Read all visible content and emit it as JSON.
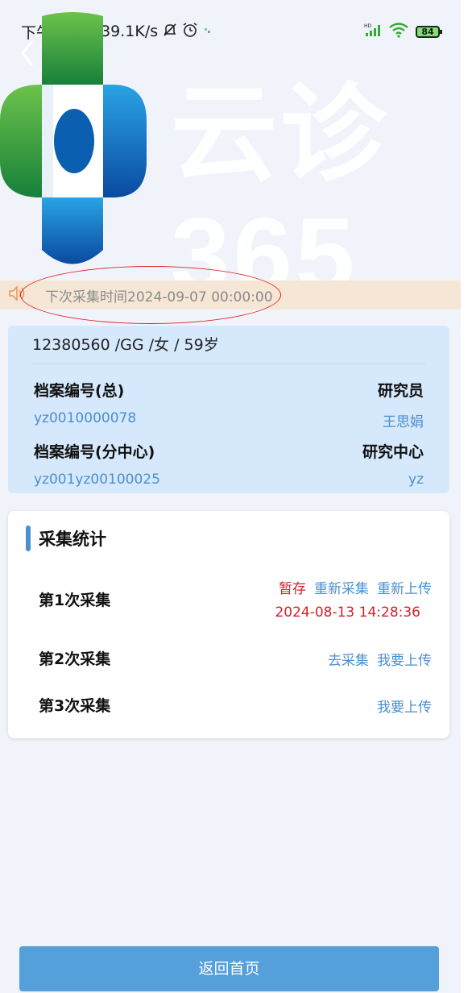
{
  "status_bar": {
    "time": "下午2:36",
    "speed": "39.1K/s",
    "battery": "84"
  },
  "header": {
    "brand": "云诊365"
  },
  "notice": {
    "text": "下次采集时间2024-09-07 00:00:00"
  },
  "patient": {
    "summary": "12380560 /GG /女 / 59岁",
    "archive_total_label": "档案编号(总)",
    "archive_total_value": "yz0010000078",
    "researcher_label": "研究员",
    "researcher_value": "王思娟",
    "archive_sub_label": "档案编号(分中心)",
    "archive_sub_value": "yz001yz00100025",
    "center_label": "研究中心",
    "center_value": "yz"
  },
  "stats": {
    "title": "采集统计",
    "rounds": [
      {
        "label": "第1次采集",
        "actions": [
          "暂存",
          "重新采集",
          "重新上传"
        ],
        "timestamp": "2024-08-13 14:28:36"
      },
      {
        "label": "第2次采集",
        "actions": [
          "去采集",
          "我要上传"
        ]
      },
      {
        "label": "第3次采集",
        "actions": [
          "我要上传"
        ]
      }
    ]
  },
  "footer": {
    "home_button": "返回首页"
  },
  "colors": {
    "accent_blue": "#4a8fd0",
    "alert_red": "#d0232a",
    "notice_bg": "#f6e6d6",
    "card_bg": "#d6e8fc"
  }
}
